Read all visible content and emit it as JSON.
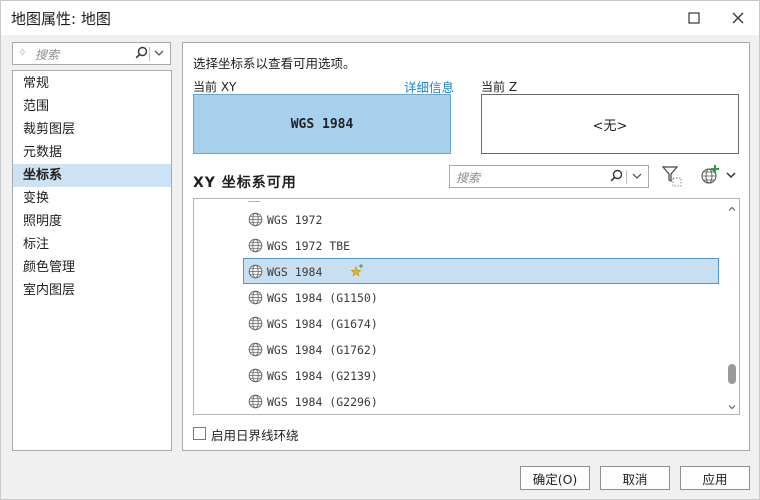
{
  "window": {
    "title": "地图属性: 地图"
  },
  "left_search": {
    "placeholder": "搜索"
  },
  "nav": {
    "items": [
      {
        "label": "常规"
      },
      {
        "label": "范围"
      },
      {
        "label": "裁剪图层"
      },
      {
        "label": "元数据"
      },
      {
        "label": "坐标系",
        "active": true
      },
      {
        "label": "变换"
      },
      {
        "label": "照明度"
      },
      {
        "label": "标注"
      },
      {
        "label": "颜色管理"
      },
      {
        "label": "室内图层"
      }
    ]
  },
  "coord": {
    "instruction": "选择坐标系以查看可用选项。",
    "current_xy_label": "当前 XY",
    "detail_link": "详细信息",
    "current_z_label": "当前 Z",
    "current_xy_value": "WGS 1984",
    "current_z_value": "<无>",
    "section_title": "XY 坐标系可用",
    "search_placeholder": "搜索",
    "list": [
      {
        "name": "WGS 1972"
      },
      {
        "name": "WGS 1972 TBE"
      },
      {
        "name": "WGS 1984",
        "selected": true,
        "favorite": true
      },
      {
        "name": "WGS 1984 (G1150)"
      },
      {
        "name": "WGS 1984 (G1674)"
      },
      {
        "name": "WGS 1984 (G1762)"
      },
      {
        "name": "WGS 1984 (G2139)"
      },
      {
        "name": "WGS 1984 (G2296)"
      }
    ],
    "wrap_label": "启用日界线环绕",
    "wrap_checked": false
  },
  "buttons": {
    "ok": "确定(O)",
    "cancel": "取消",
    "apply": "应用"
  },
  "colors": {
    "accent": "#1a88c9",
    "selection": "#c7dff1",
    "current_box": "#a7d0ec"
  },
  "icons": [
    "search-icon",
    "chevron-down-icon",
    "filter-icon",
    "globe-add-icon",
    "globe-icon",
    "favorite-star-icon",
    "maximize-icon",
    "close-icon"
  ]
}
